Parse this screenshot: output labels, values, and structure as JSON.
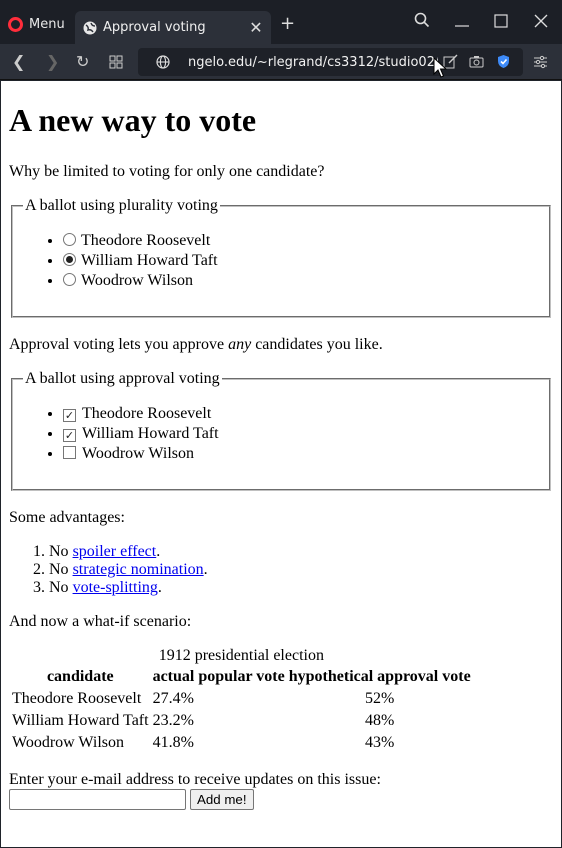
{
  "browser": {
    "menu_label": "Menu",
    "tab_title": "Approval voting",
    "url": "ngelo.edu/~rlegrand/cs3312/studio02/"
  },
  "page": {
    "heading": "A new way to vote",
    "intro": "Why be limited to voting for only one candidate?",
    "plurality": {
      "legend": "A ballot using plurality voting",
      "options": [
        {
          "label": "Theodore Roosevelt",
          "selected": false
        },
        {
          "label": "William Howard Taft",
          "selected": true
        },
        {
          "label": "Woodrow Wilson",
          "selected": false
        }
      ]
    },
    "approval_text": {
      "before": "Approval voting lets you approve ",
      "em": "any",
      "after": " candidates you like."
    },
    "approval": {
      "legend": "A ballot using approval voting",
      "options": [
        {
          "label": "Theodore Roosevelt",
          "checked": true
        },
        {
          "label": "William Howard Taft",
          "checked": true
        },
        {
          "label": "Woodrow Wilson",
          "checked": false
        }
      ]
    },
    "advantages_heading": "Some advantages:",
    "advantages": [
      {
        "prefix": "No ",
        "link": "spoiler effect",
        "suffix": "."
      },
      {
        "prefix": "No ",
        "link": "strategic nomination",
        "suffix": "."
      },
      {
        "prefix": "No ",
        "link": "vote-splitting",
        "suffix": "."
      }
    ],
    "whatif": "And now a what-if scenario:",
    "table": {
      "caption": "1912 presidential election",
      "headers": [
        "candidate",
        "actual popular vote",
        "hypothetical approval vote"
      ],
      "rows": [
        [
          "Theodore Roosevelt",
          "27.4%",
          "52%"
        ],
        [
          "William Howard Taft",
          "23.2%",
          "48%"
        ],
        [
          "Woodrow Wilson",
          "41.8%",
          "43%"
        ]
      ]
    },
    "email_prompt": "Enter your e-mail address to receive updates on this issue:",
    "email_value": "",
    "submit_label": "Add me!"
  }
}
